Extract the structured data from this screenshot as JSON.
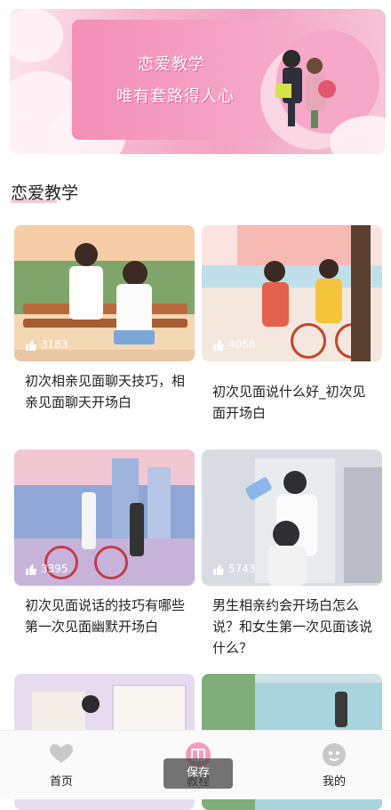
{
  "banner": {
    "line1": "恋爱教学",
    "line2": "唯有套路得人心"
  },
  "section": {
    "title": "恋爱教学"
  },
  "cards": [
    {
      "likes": "3183",
      "title": "初次相亲见面聊天技巧，相亲见面聊天开场白"
    },
    {
      "likes": "4058",
      "title": "初次见面说什么好_初次见面开场白"
    },
    {
      "likes": "3395",
      "title": "初次见面说话的技巧有哪些 第一次见面幽默开场白"
    },
    {
      "likes": "5743",
      "title": "男生相亲约会开场白怎么说？和女生第一次见面该说什么？"
    }
  ],
  "tabbar": {
    "home": "首页",
    "tutorial": "教程",
    "mine": "我的"
  },
  "toast": "保存",
  "colors": {
    "accent_pink": "#f39bbd",
    "tab_icon": "#c9c9c9"
  }
}
